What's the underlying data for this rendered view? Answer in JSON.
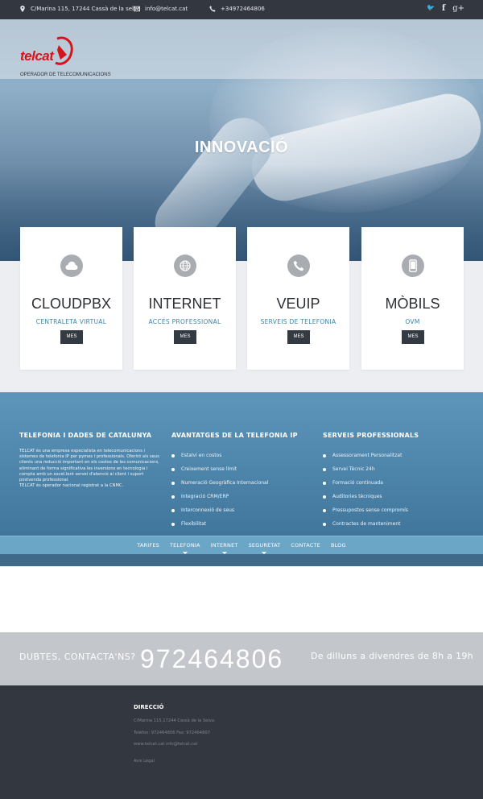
{
  "topbar": {
    "address": "C/Marina 115, 17244 Cassà de la selva",
    "email": "info@telcat.cat",
    "phone": "+34972464806",
    "social": [
      "twitter-icon",
      "facebook-icon",
      "google-plus-icon"
    ],
    "social_glyphs": [
      "🐦",
      "f",
      "g+"
    ]
  },
  "brand": {
    "logo_text": "telcat",
    "tagline": "OPERADOR DE TELECOMUNICACIONS",
    "logo_color": "#d4161c"
  },
  "hero": {
    "title": "INNOVACIÓ"
  },
  "services": [
    {
      "title": "CLOUDPBX",
      "subtitle": "CENTRALETA VIRTUAL",
      "icon": "cloud-icon",
      "button": "MES"
    },
    {
      "title": "INTERNET",
      "subtitle": "ACCÉS PROFESSIONAL",
      "icon": "globe-icon",
      "button": "MES"
    },
    {
      "title": "VEUIP",
      "subtitle": "SERVEIS DE TELEFONIA",
      "icon": "phone-icon",
      "button": "MES"
    },
    {
      "title": "MÒBILS",
      "subtitle": "OVM",
      "icon": "mobile-icon",
      "button": "MES"
    }
  ],
  "info": {
    "col1": {
      "title": "TELEFONIA I DADES DE CATALUNYA",
      "text": "TELCAT és una empresa especialista en telecomunicacions i sistemes de telefonia IP per pymes i professionals. Oferint als seus clients una reducció important en els costos de les comunicacions, eliminant de forma significativa les inversions en tecnologia i compta amb un excel.lent servei d'atenció al client i suport postvenda professional.",
      "text2": "TELCAT és operador nacional registrat a la CNMC."
    },
    "col2": {
      "title": "AVANTATGES DE LA TELEFONIA IP",
      "items": [
        "Estalvi en costos",
        "Creixement sense límit",
        "Numeració Geogràfica Internacional",
        "Integració CRM/ERP",
        "Interconnexió de seus",
        "Flexibilitat"
      ]
    },
    "col3": {
      "title": "SERVEIS PROFESSIONALS",
      "items": [
        "Assessorament Personalitzat",
        "Servei Tècnic 24h",
        "Formació continuada",
        "Auditories tècniques",
        "Pressupostos sense compromís",
        "Contractes de manteniment"
      ]
    }
  },
  "nav": [
    {
      "label": "TARIFES",
      "dropdown": false
    },
    {
      "label": "TELEFONIA",
      "dropdown": true
    },
    {
      "label": "INTERNET",
      "dropdown": true
    },
    {
      "label": "SEGURETAT",
      "dropdown": true
    },
    {
      "label": "CONTACTE",
      "dropdown": false
    },
    {
      "label": "BLOG",
      "dropdown": false
    }
  ],
  "contact": {
    "prompt": "DUBTES, CONTACTA'NS?",
    "phone": "972464806",
    "hours": "De dilluns a divendres de 8h a 19h"
  },
  "footer": {
    "title": "DIRECCIÓ",
    "address": "C/Marina 115,17244 Cassà de la Selva",
    "phones": "Telèfon: 972464806 Fax: 972464807",
    "web": "www.telcat.cat info@telcat.cat",
    "legal": "Avis Legal"
  }
}
